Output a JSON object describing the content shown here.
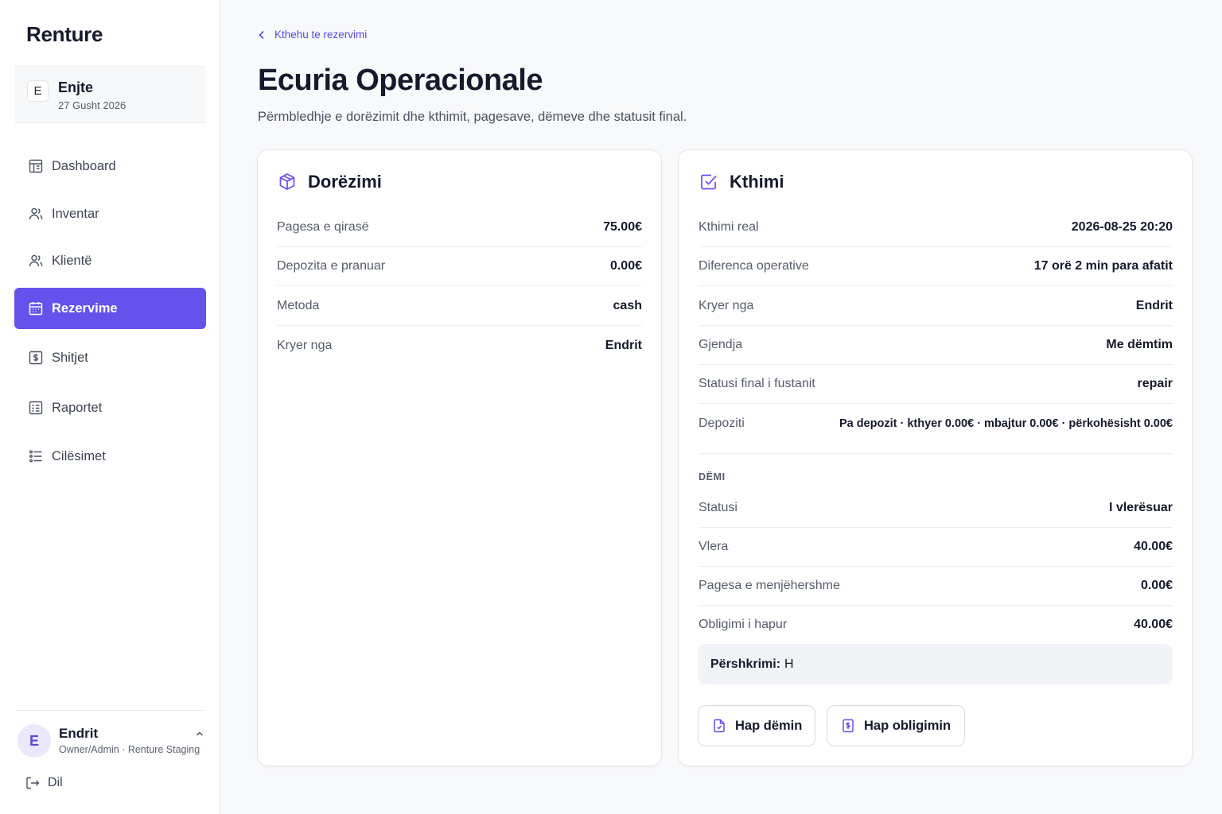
{
  "app": {
    "brand": "Renture"
  },
  "date_card": {
    "badge": "E",
    "day": "Enjte",
    "date": "27 Gusht 2026"
  },
  "sidebar": {
    "items": [
      {
        "label": "Dashboard",
        "icon": "dashboard-icon"
      },
      {
        "label": "Inventar",
        "icon": "users-icon"
      },
      {
        "label": "Klientë",
        "icon": "users-icon"
      },
      {
        "label": "Rezervime",
        "icon": "calendar-icon",
        "active": true
      },
      {
        "label": "Shitjet",
        "icon": "sales-icon"
      },
      {
        "label": "Raportet",
        "icon": "report-icon"
      },
      {
        "label": "Cilësimet",
        "icon": "settings-list-icon"
      }
    ]
  },
  "user": {
    "initial": "E",
    "name": "Endrit",
    "role": "Owner/Admin · Renture Staging"
  },
  "logout_label": "Dil",
  "header": {
    "back_label": "Kthehu te rezervimi",
    "title": "Ecuria Operacionale",
    "subtitle": "Përmbledhje e dorëzimit dhe kthimit, pagesave, dëmeve dhe statusit final."
  },
  "delivery": {
    "title": "Dorëzimi",
    "rows": [
      {
        "label": "Pagesa e qirasë",
        "value": "75.00€"
      },
      {
        "label": "Depozita e pranuar",
        "value": "0.00€"
      },
      {
        "label": "Metoda",
        "value": "cash"
      },
      {
        "label": "Kryer nga",
        "value": "Endrit"
      }
    ]
  },
  "return": {
    "title": "Kthimi",
    "rows": [
      {
        "label": "Kthimi real",
        "value": "2026-08-25 20:20"
      },
      {
        "label": "Diferenca operative",
        "value": "17 orë 2 min para afatit"
      },
      {
        "label": "Kryer nga",
        "value": "Endrit"
      },
      {
        "label": "Gjendja",
        "value": "Me dëmtim"
      },
      {
        "label": "Statusi final i fustanit",
        "value": "repair"
      },
      {
        "label": "Depoziti",
        "value": "Pa depozit · kthyer 0.00€ · mbajtur 0.00€ · përkohësisht 0.00€"
      }
    ],
    "damage": {
      "section_label": "DËMI",
      "rows": [
        {
          "label": "Statusi",
          "value": "I vlerësuar"
        },
        {
          "label": "Vlera",
          "value": "40.00€"
        },
        {
          "label": "Pagesa e menjëhershme",
          "value": "0.00€"
        },
        {
          "label": "Obligimi i hapur",
          "value": "40.00€"
        }
      ],
      "description_label": "Përshkrimi:",
      "description_value": "H"
    },
    "buttons": {
      "open_damage": "Hap dëmin",
      "open_obligation": "Hap obligimin"
    }
  },
  "colors": {
    "accent": "#6452ec",
    "text": "#151a2d",
    "muted": "#555c6a"
  }
}
